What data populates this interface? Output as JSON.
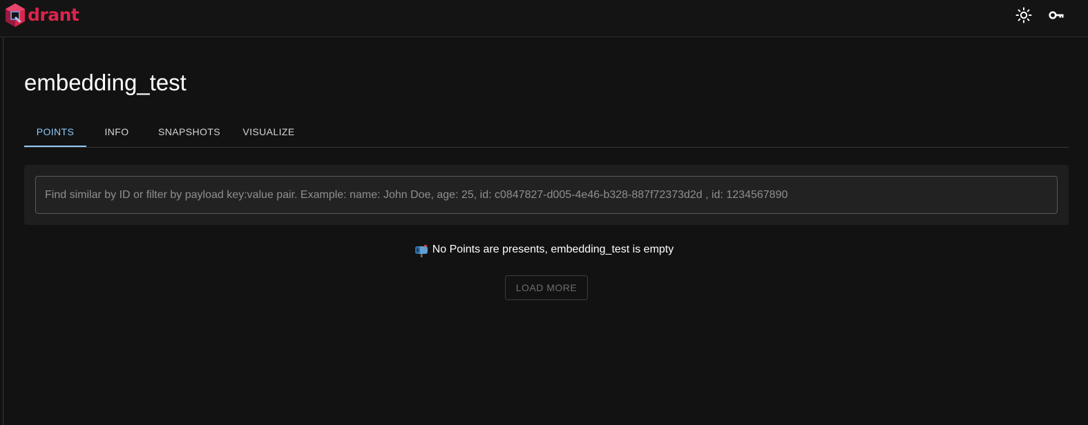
{
  "app": {
    "logo_text": "drant",
    "theme_icon": "sun-icon",
    "api_key_icon": "key-icon"
  },
  "colors": {
    "brand": "#dc244c",
    "accent": "#90caf9",
    "background": "#121212"
  },
  "collection": {
    "title": "embedding_test"
  },
  "tabs": [
    {
      "label": "POINTS",
      "active": true
    },
    {
      "label": "INFO",
      "active": false
    },
    {
      "label": "SNAPSHOTS",
      "active": false
    },
    {
      "label": "VISUALIZE",
      "active": false
    }
  ],
  "search": {
    "placeholder": "Find similar by ID or filter by payload key:value pair. Example: name: John Doe, age: 25, id: c0847827-d005-4e46-b328-887f72373d2d , id: 1234567890",
    "value": ""
  },
  "empty_state": {
    "icon": "mailbox-icon",
    "message": "No Points are presents, embedding_test is empty"
  },
  "actions": {
    "load_more_label": "LOAD MORE"
  }
}
